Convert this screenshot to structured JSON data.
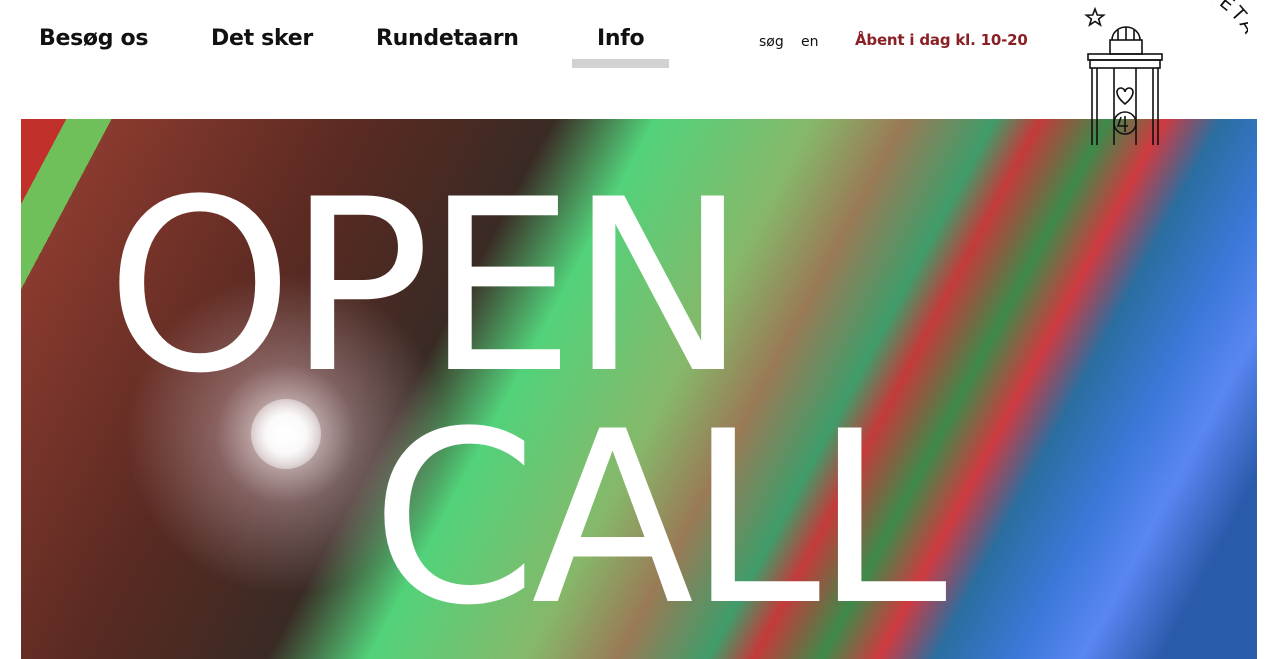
{
  "nav": {
    "items": [
      {
        "label": "Besøg os"
      },
      {
        "label": "Det sker"
      },
      {
        "label": "Rundetaarn"
      },
      {
        "label": "Info",
        "active": true
      }
    ]
  },
  "utility": {
    "search_label": "søg",
    "language_label": "en",
    "opening_hours": "Åbent i dag kl. 10-20"
  },
  "logo": {
    "text": "RUNDETAARN",
    "icons": [
      "star-icon",
      "tower-icon"
    ]
  },
  "hero": {
    "line1": "OPEN",
    "line2": "CALL"
  },
  "colors": {
    "accent": "#8a1f25",
    "nav_indicator": "#d2d2d2"
  }
}
